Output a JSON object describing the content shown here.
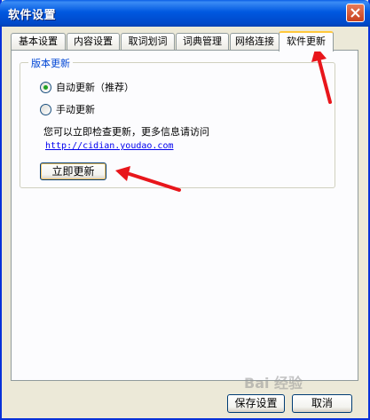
{
  "window": {
    "title": "软件设置"
  },
  "tabs": [
    {
      "label": "基本设置",
      "active": false
    },
    {
      "label": "内容设置",
      "active": false
    },
    {
      "label": "取词划词",
      "active": false
    },
    {
      "label": "词典管理",
      "active": false
    },
    {
      "label": "网络连接",
      "active": false
    },
    {
      "label": "软件更新",
      "active": true
    }
  ],
  "update": {
    "group_label": "版本更新",
    "option_auto": "自动更新（推荐）",
    "option_manual": "手动更新",
    "selected": "auto",
    "info_text": "您可以立即检查更新，更多信息请访问",
    "link_text": "http://cidian.youdao.com",
    "update_button": "立即更新"
  },
  "footer": {
    "save_label": "保存设置",
    "cancel_label": "取消"
  },
  "watermark": "Bai 经验",
  "colors": {
    "annotation_arrow": "#e8161b",
    "titlebar": "#0058e0",
    "active_tab_accent": "#ffc83c"
  }
}
